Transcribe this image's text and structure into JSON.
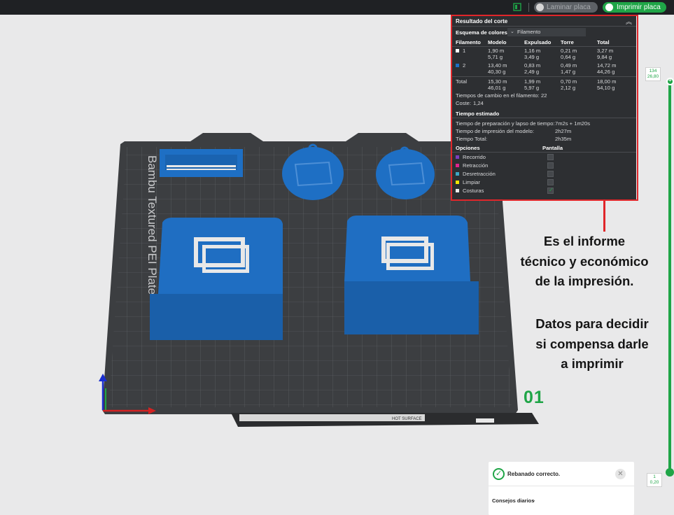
{
  "topbar": {
    "slice_label": "Laminar placa",
    "print_label": "Imprimir placa"
  },
  "plate": {
    "brand_text": "Bambu Textured PEI Plate",
    "number": "01",
    "hot_surface_label": "HOT SURFACE"
  },
  "panel": {
    "title": "Resultado del corte",
    "scheme_label": "Esquema de colores",
    "scheme_value": "Filamento",
    "columns": [
      "Filamento",
      "Modelo",
      "Expulsado",
      "Torre",
      "Total"
    ],
    "rows": [
      {
        "id": "1",
        "color": "#ffffff",
        "modelo_m": "1,90 m",
        "modelo_g": "5,71 g",
        "expulsado_m": "1,16 m",
        "expulsado_g": "3,49 g",
        "torre_m": "0,21 m",
        "torre_g": "0,64 g",
        "total_m": "3,27 m",
        "total_g": "9,84 g"
      },
      {
        "id": "2",
        "color": "#1e6fc4",
        "modelo_m": "13,40 m",
        "modelo_g": "40,30 g",
        "expulsado_m": "0,83 m",
        "expulsado_g": "2,49 g",
        "torre_m": "0,49 m",
        "torre_g": "1,47 g",
        "total_m": "14,72 m",
        "total_g": "44,26 g"
      }
    ],
    "total_row": {
      "label": "Total",
      "modelo_m": "15,30 m",
      "modelo_g": "46,01 g",
      "expulsado_m": "1,99 m",
      "expulsado_g": "5,97 g",
      "torre_m": "0,70 m",
      "torre_g": "2,12 g",
      "total_m": "18,00 m",
      "total_g": "54,10 g"
    },
    "filament_changes_label": "Tiempos de cambio en el filamento:",
    "filament_changes_value": "22",
    "cost_label": "Coste:",
    "cost_value": "1,24",
    "time_title": "Tiempo estimado",
    "prep_label": "Tiempo de preparación y lapso de tiempo:",
    "prep_value": "7m2s + 1m20s",
    "model_time_label": "Tiempo de impresión del modelo:",
    "model_time_value": "2h27m",
    "total_time_label": "Tiempo Total:",
    "total_time_value": "2h35m",
    "options_title": "Opciones",
    "display_title": "Pantalla",
    "options": [
      {
        "label": "Recorrido",
        "color": "#7b3fbf",
        "checked": false
      },
      {
        "label": "Retracción",
        "color": "#e0248e",
        "checked": false
      },
      {
        "label": "Desretracción",
        "color": "#3fa7c4",
        "checked": false
      },
      {
        "label": "Limpiar",
        "color": "#f2e600",
        "checked": false
      },
      {
        "label": "Costuras",
        "color": "#ececec",
        "checked": true
      }
    ]
  },
  "annotation": {
    "line1": "Es el informe",
    "line2": "técnico y económico",
    "line3": "de la impresión.",
    "line4": "Datos para decidir",
    "line5": "si compensa darle",
    "line6": "a imprimir"
  },
  "slider": {
    "top_layer": "134",
    "top_height": "26,80",
    "bottom_layer": "1",
    "bottom_height": "0,20"
  },
  "notification": {
    "message": "Rebanado correcto.",
    "tips_label": "Consejos diarios"
  },
  "colors": {
    "accent_green": "#1fa547",
    "highlight_red": "#e0262a",
    "model_blue": "#1e6fc4"
  }
}
